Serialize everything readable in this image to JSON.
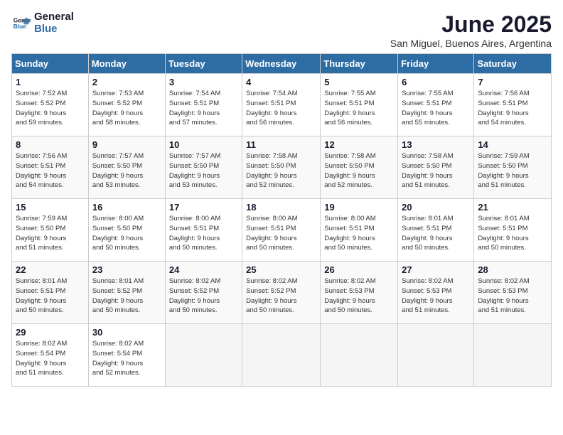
{
  "header": {
    "logo_line1": "General",
    "logo_line2": "Blue",
    "month": "June 2025",
    "location": "San Miguel, Buenos Aires, Argentina"
  },
  "weekdays": [
    "Sunday",
    "Monday",
    "Tuesday",
    "Wednesday",
    "Thursday",
    "Friday",
    "Saturday"
  ],
  "weeks": [
    [
      {
        "day": "1",
        "info": "Sunrise: 7:52 AM\nSunset: 5:52 PM\nDaylight: 9 hours\nand 59 minutes."
      },
      {
        "day": "2",
        "info": "Sunrise: 7:53 AM\nSunset: 5:52 PM\nDaylight: 9 hours\nand 58 minutes."
      },
      {
        "day": "3",
        "info": "Sunrise: 7:54 AM\nSunset: 5:51 PM\nDaylight: 9 hours\nand 57 minutes."
      },
      {
        "day": "4",
        "info": "Sunrise: 7:54 AM\nSunset: 5:51 PM\nDaylight: 9 hours\nand 56 minutes."
      },
      {
        "day": "5",
        "info": "Sunrise: 7:55 AM\nSunset: 5:51 PM\nDaylight: 9 hours\nand 56 minutes."
      },
      {
        "day": "6",
        "info": "Sunrise: 7:55 AM\nSunset: 5:51 PM\nDaylight: 9 hours\nand 55 minutes."
      },
      {
        "day": "7",
        "info": "Sunrise: 7:56 AM\nSunset: 5:51 PM\nDaylight: 9 hours\nand 54 minutes."
      }
    ],
    [
      {
        "day": "8",
        "info": "Sunrise: 7:56 AM\nSunset: 5:51 PM\nDaylight: 9 hours\nand 54 minutes."
      },
      {
        "day": "9",
        "info": "Sunrise: 7:57 AM\nSunset: 5:50 PM\nDaylight: 9 hours\nand 53 minutes."
      },
      {
        "day": "10",
        "info": "Sunrise: 7:57 AM\nSunset: 5:50 PM\nDaylight: 9 hours\nand 53 minutes."
      },
      {
        "day": "11",
        "info": "Sunrise: 7:58 AM\nSunset: 5:50 PM\nDaylight: 9 hours\nand 52 minutes."
      },
      {
        "day": "12",
        "info": "Sunrise: 7:58 AM\nSunset: 5:50 PM\nDaylight: 9 hours\nand 52 minutes."
      },
      {
        "day": "13",
        "info": "Sunrise: 7:58 AM\nSunset: 5:50 PM\nDaylight: 9 hours\nand 51 minutes."
      },
      {
        "day": "14",
        "info": "Sunrise: 7:59 AM\nSunset: 5:50 PM\nDaylight: 9 hours\nand 51 minutes."
      }
    ],
    [
      {
        "day": "15",
        "info": "Sunrise: 7:59 AM\nSunset: 5:50 PM\nDaylight: 9 hours\nand 51 minutes."
      },
      {
        "day": "16",
        "info": "Sunrise: 8:00 AM\nSunset: 5:50 PM\nDaylight: 9 hours\nand 50 minutes."
      },
      {
        "day": "17",
        "info": "Sunrise: 8:00 AM\nSunset: 5:51 PM\nDaylight: 9 hours\nand 50 minutes."
      },
      {
        "day": "18",
        "info": "Sunrise: 8:00 AM\nSunset: 5:51 PM\nDaylight: 9 hours\nand 50 minutes."
      },
      {
        "day": "19",
        "info": "Sunrise: 8:00 AM\nSunset: 5:51 PM\nDaylight: 9 hours\nand 50 minutes."
      },
      {
        "day": "20",
        "info": "Sunrise: 8:01 AM\nSunset: 5:51 PM\nDaylight: 9 hours\nand 50 minutes."
      },
      {
        "day": "21",
        "info": "Sunrise: 8:01 AM\nSunset: 5:51 PM\nDaylight: 9 hours\nand 50 minutes."
      }
    ],
    [
      {
        "day": "22",
        "info": "Sunrise: 8:01 AM\nSunset: 5:51 PM\nDaylight: 9 hours\nand 50 minutes."
      },
      {
        "day": "23",
        "info": "Sunrise: 8:01 AM\nSunset: 5:52 PM\nDaylight: 9 hours\nand 50 minutes."
      },
      {
        "day": "24",
        "info": "Sunrise: 8:02 AM\nSunset: 5:52 PM\nDaylight: 9 hours\nand 50 minutes."
      },
      {
        "day": "25",
        "info": "Sunrise: 8:02 AM\nSunset: 5:52 PM\nDaylight: 9 hours\nand 50 minutes."
      },
      {
        "day": "26",
        "info": "Sunrise: 8:02 AM\nSunset: 5:53 PM\nDaylight: 9 hours\nand 50 minutes."
      },
      {
        "day": "27",
        "info": "Sunrise: 8:02 AM\nSunset: 5:53 PM\nDaylight: 9 hours\nand 51 minutes."
      },
      {
        "day": "28",
        "info": "Sunrise: 8:02 AM\nSunset: 5:53 PM\nDaylight: 9 hours\nand 51 minutes."
      }
    ],
    [
      {
        "day": "29",
        "info": "Sunrise: 8:02 AM\nSunset: 5:54 PM\nDaylight: 9 hours\nand 51 minutes."
      },
      {
        "day": "30",
        "info": "Sunrise: 8:02 AM\nSunset: 5:54 PM\nDaylight: 9 hours\nand 52 minutes."
      },
      null,
      null,
      null,
      null,
      null
    ]
  ]
}
